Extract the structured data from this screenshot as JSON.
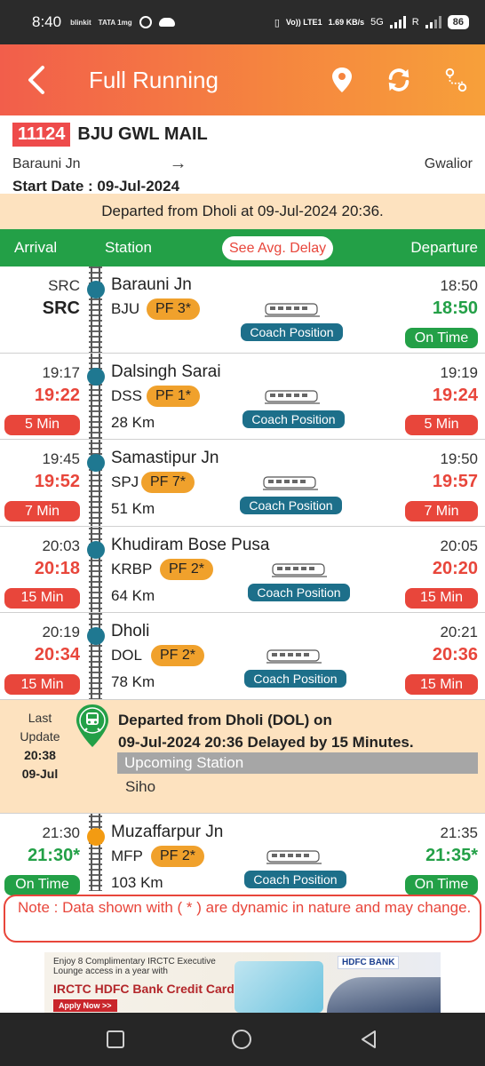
{
  "status_bar": {
    "time": "8:40",
    "apps": [
      "blinkit",
      "TATA 1mg"
    ],
    "network_volte": "Vo)) LTE1",
    "speed": "1.69 KB/s",
    "network": "5G",
    "roaming": "R",
    "battery": "86"
  },
  "header": {
    "title": "Full Running",
    "icons": [
      "back-arrow-icon",
      "location-pin-icon",
      "refresh-icon",
      "route-icon"
    ]
  },
  "train": {
    "number": "11124",
    "name": "BJU GWL MAIL",
    "from": "Barauni Jn",
    "arrow": "→",
    "to": "Gwalior",
    "start_date": "Start Date : 09-Jul-2024"
  },
  "departed_banner": "Departed from Dholi at 09-Jul-2024 20:36.",
  "columns": {
    "arrival": "Arrival",
    "station": "Station",
    "avg_delay": "See Avg. Delay",
    "departure": "Departure"
  },
  "coach_position_label": "Coach Position",
  "stations": [
    {
      "arr_sched": "SRC",
      "arr_actual": "SRC",
      "arr_badge": "",
      "name": "Barauni Jn",
      "code": "BJU",
      "pf": "PF 3*",
      "km": "",
      "dep_sched": "18:50",
      "dep_actual": "18:50",
      "dep_badge": "On Time",
      "arr_color": "black",
      "dep_color": "green",
      "dep_badge_color": "green",
      "dot": "blue"
    },
    {
      "arr_sched": "19:17",
      "arr_actual": "19:22",
      "arr_badge": "5 Min",
      "name": "Dalsingh Sarai",
      "code": "DSS",
      "pf": "PF 1*",
      "km": "28 Km",
      "dep_sched": "19:19",
      "dep_actual": "19:24",
      "dep_badge": "5 Min",
      "arr_color": "red",
      "dep_color": "red",
      "dep_badge_color": "red",
      "dot": "blue"
    },
    {
      "arr_sched": "19:45",
      "arr_actual": "19:52",
      "arr_badge": "7 Min",
      "name": "Samastipur Jn",
      "code": "SPJ",
      "pf": "PF 7*",
      "km": "51 Km",
      "dep_sched": "19:50",
      "dep_actual": "19:57",
      "dep_badge": "7 Min",
      "arr_color": "red",
      "dep_color": "red",
      "dep_badge_color": "red",
      "dot": "blue"
    },
    {
      "arr_sched": "20:03",
      "arr_actual": "20:18",
      "arr_badge": "15 Min",
      "name": "Khudiram Bose Pusa",
      "code": "KRBP",
      "pf": "PF 2*",
      "km": "64 Km",
      "dep_sched": "20:05",
      "dep_actual": "20:20",
      "dep_badge": "15 Min",
      "arr_color": "red",
      "dep_color": "red",
      "dep_badge_color": "red",
      "dot": "blue"
    },
    {
      "arr_sched": "20:19",
      "arr_actual": "20:34",
      "arr_badge": "15 Min",
      "name": "Dholi",
      "code": "DOL",
      "pf": "PF 2*",
      "km": "78 Km",
      "dep_sched": "20:21",
      "dep_actual": "20:36",
      "dep_badge": "15 Min",
      "arr_color": "red",
      "dep_color": "red",
      "dep_badge_color": "red",
      "dot": "blue"
    }
  ],
  "last_update": {
    "label1": "Last",
    "label2": "Update",
    "time": "20:38",
    "date": "09-Jul",
    "message_line1": "Departed from Dholi (DOL) on",
    "message_line2": "09-Jul-2024 20:36 Delayed by 15 Minutes.",
    "upcoming_label": "Upcoming Station",
    "upcoming_station": "Siho"
  },
  "next_station": {
    "arr_sched": "21:30",
    "arr_actual": "21:30*",
    "arr_badge": "On Time",
    "name": "Muzaffarpur Jn",
    "code": "MFP",
    "pf": "PF 2*",
    "km": "103 Km",
    "dep_sched": "21:35",
    "dep_actual": "21:35*",
    "dep_badge": "On Time",
    "arr_color": "green",
    "dep_color": "green",
    "dep_badge_color": "green",
    "dot": "orange"
  },
  "note": "Note : Data shown with ( * ) are dynamic in nature and may change.",
  "ad": {
    "line1": "Enjoy 8 Complimentary IRCTC Executive",
    "line1b": "Lounge access in a year with",
    "headline": "IRCTC HDFC Bank Credit Card",
    "cta": "Apply Now >>",
    "bank": "HDFC BANK"
  },
  "colors": {
    "header_start": "#f25e4b",
    "header_end": "#f7a03a",
    "green": "#23a047",
    "red": "#e8463b",
    "pf_orange": "#f0a12c",
    "coach_teal": "#1d6f8a",
    "banner_peach": "#fde2bf"
  }
}
